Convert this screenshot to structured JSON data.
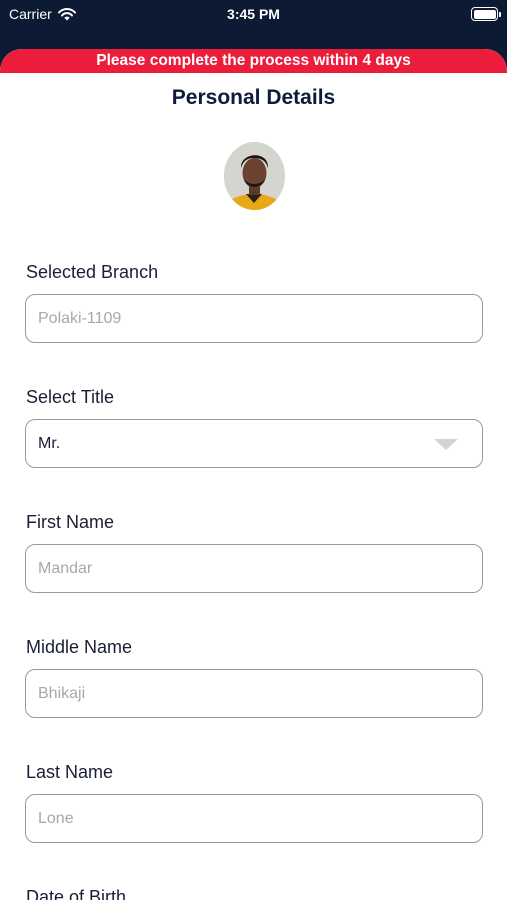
{
  "status_bar": {
    "carrier": "Carrier",
    "time": "3:45 PM"
  },
  "banner": {
    "text": "Please complete the process within 4 days",
    "color": "#ec1d3b"
  },
  "page": {
    "title": "Personal Details"
  },
  "form": {
    "branch": {
      "label": "Selected Branch",
      "value": "Polaki-1109"
    },
    "title": {
      "label": "Select Title",
      "value": "Mr."
    },
    "first_name": {
      "label": "First Name",
      "value": "Mandar"
    },
    "middle_name": {
      "label": "Middle Name",
      "value": "Bhikaji"
    },
    "last_name": {
      "label": "Last Name",
      "value": "Lone"
    },
    "dob": {
      "label": "Date of Birth"
    }
  }
}
